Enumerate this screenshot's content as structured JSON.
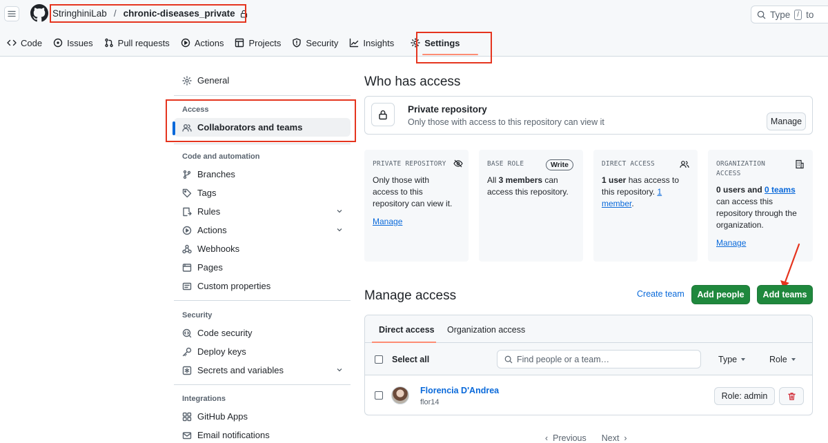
{
  "header": {
    "owner": "StringhiniLab",
    "separator": "/",
    "repo": "chronic-diseases_private",
    "search_placeholder": "Type",
    "search_key": "/",
    "search_suffix": "to"
  },
  "nav": {
    "tabs": [
      {
        "label": "Code",
        "icon": "code-icon"
      },
      {
        "label": "Issues",
        "icon": "issue-icon"
      },
      {
        "label": "Pull requests",
        "icon": "pull-request-icon"
      },
      {
        "label": "Actions",
        "icon": "play-icon"
      },
      {
        "label": "Projects",
        "icon": "table-icon"
      },
      {
        "label": "Security",
        "icon": "shield-icon"
      },
      {
        "label": "Insights",
        "icon": "graph-icon"
      },
      {
        "label": "Settings",
        "icon": "gear-icon",
        "active": true
      }
    ]
  },
  "sidebar": {
    "general": "General",
    "sections": {
      "access": "Access",
      "code_automation": "Code and automation",
      "security": "Security",
      "integrations": "Integrations"
    },
    "items": {
      "collaborators": "Collaborators and teams",
      "branches": "Branches",
      "tags": "Tags",
      "rules": "Rules",
      "actions": "Actions",
      "webhooks": "Webhooks",
      "pages": "Pages",
      "custom_properties": "Custom properties",
      "code_security": "Code security",
      "deploy_keys": "Deploy keys",
      "secrets": "Secrets and variables",
      "github_apps": "GitHub Apps",
      "email_notifications": "Email notifications"
    }
  },
  "who_has_access": {
    "title": "Who has access",
    "visibility_title": "Private repository",
    "visibility_desc": "Only those with access to this repository can view it",
    "manage": "Manage",
    "cards": {
      "private": {
        "title": "PRIVATE REPOSITORY",
        "line1": "Only those with",
        "line2": "access to this",
        "line3": "repository can view it.",
        "link": "Manage"
      },
      "base_role": {
        "title": "BASE ROLE",
        "badge": "Write",
        "pre": "All ",
        "bold": "3 members",
        "post": " can",
        "line2": "access this repository."
      },
      "direct": {
        "title": "DIRECT ACCESS",
        "bold": "1 user",
        "post": " has access to",
        "line2": "this repository. ",
        "link1": "1",
        "link2": "member",
        "end": "."
      },
      "org": {
        "title1": "ORGANIZATION",
        "title2": "ACCESS",
        "bold1": "0 users",
        "and": " and ",
        "link_teams": "0 teams",
        "line2": "can access this",
        "line3": "repository through the",
        "line4": "organization.",
        "link": "Manage"
      }
    }
  },
  "manage_access": {
    "title": "Manage access",
    "create_team": "Create team",
    "add_people": "Add people",
    "add_teams": "Add teams",
    "tabs": [
      "Direct access",
      "Organization access"
    ],
    "select_all": "Select all",
    "find_placeholder": "Find people or a team…",
    "type_label": "Type",
    "role_label": "Role",
    "member": {
      "name": "Florencia D'Andrea",
      "login": "flor14",
      "role": "Role: admin"
    }
  },
  "pagination": {
    "previous": "Previous",
    "next": "Next",
    "prev_arrow": "‹",
    "next_arrow": "›"
  },
  "colors": {
    "accent": "#0969da",
    "primary_button": "#1f883d",
    "annotation": "#e5341e",
    "active_tab": "#fd8c73",
    "danger": "#cf222e"
  }
}
